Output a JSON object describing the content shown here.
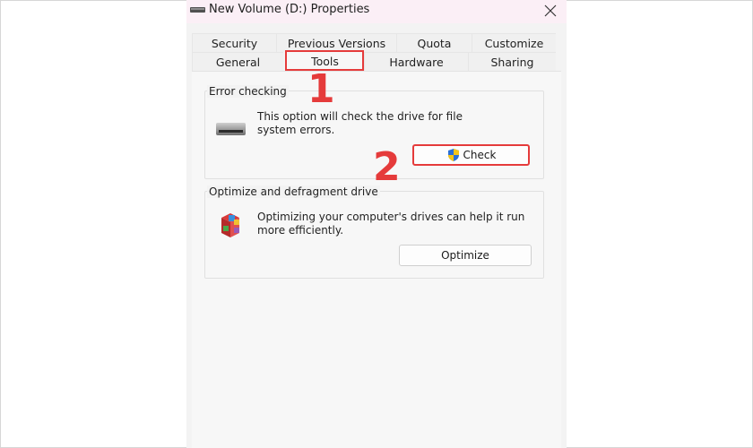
{
  "window": {
    "title": "New Volume (D:) Properties",
    "close_icon": "close-icon",
    "drive_icon": "drive-icon"
  },
  "tabs": {
    "row1": [
      "Security",
      "Previous Versions",
      "Quota",
      "Customize"
    ],
    "row2": [
      "General",
      "Tools",
      "Hardware",
      "Sharing"
    ],
    "active": "Tools"
  },
  "error_checking": {
    "title": "Error checking",
    "description_line1": "This option will check the drive for file",
    "description_line2": "system errors.",
    "icon": "hard-drive-icon",
    "button_label": "Check",
    "button_icon": "uac-shield-icon"
  },
  "optimize": {
    "title": "Optimize and defragment drive",
    "description_line1": "Optimizing your computer's drives can help it run",
    "description_line2": "more efficiently.",
    "icon": "defragment-icon",
    "button_label": "Optimize"
  },
  "annotations": {
    "step1": "1",
    "step2": "2",
    "highlight_color": "#e53b3b"
  }
}
